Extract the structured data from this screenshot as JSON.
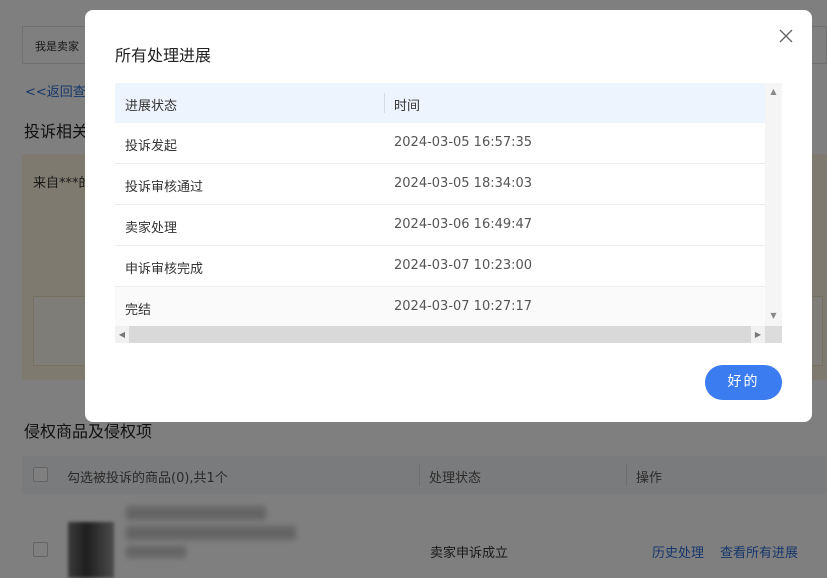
{
  "background": {
    "topbar_text": "我是卖家",
    "back_link": "<<返回查",
    "section1_title": "投诉相关",
    "notice_text": "来自***的",
    "section2_title": "侵权商品及侵权项",
    "table": {
      "select_label": "勾选被投诉的商品(0),共1个",
      "status_header": "处理状态",
      "action_header": "操作",
      "row_status": "卖家申诉成立",
      "action_history": "历史处理",
      "action_view_all": "查看所有进展"
    }
  },
  "modal": {
    "title": "所有处理进展",
    "close_icon": "close-icon",
    "columns": [
      "进展状态",
      "时间"
    ],
    "rows": [
      {
        "status": "投诉发起",
        "time": "2024-03-05 16:57:35"
      },
      {
        "status": "投诉审核通过",
        "time": "2024-03-05 18:34:03"
      },
      {
        "status": "卖家处理",
        "time": "2024-03-06 16:49:47"
      },
      {
        "status": "申诉审核完成",
        "time": "2024-03-07 10:23:00"
      },
      {
        "status": "完结",
        "time": "2024-03-07 10:27:17"
      }
    ],
    "ok_label": "好的"
  },
  "colors": {
    "accent": "#3b7cf0",
    "link": "#2f6fd6",
    "table_header_bg": "#eef4fd",
    "notice_bg": "#fdf5df"
  }
}
